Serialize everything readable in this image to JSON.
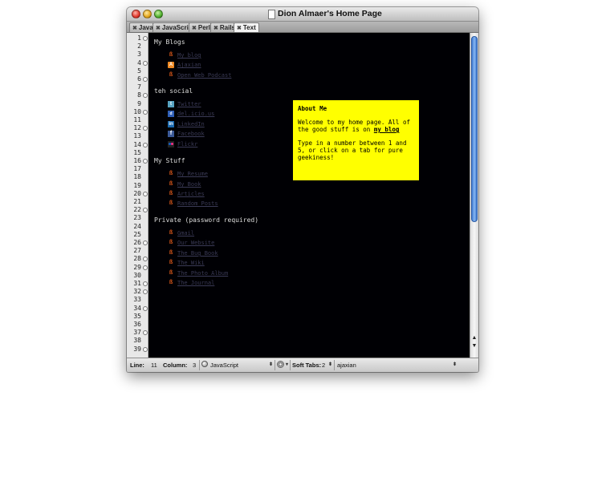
{
  "window": {
    "title": "Dion Almaer's Home Page",
    "tabs": [
      {
        "label": "Java",
        "active": false
      },
      {
        "label": "JavaScript",
        "active": false
      },
      {
        "label": "Perl",
        "active": false
      },
      {
        "label": "Rails",
        "active": false
      },
      {
        "label": "Text",
        "active": true
      }
    ]
  },
  "gutter": {
    "line_numbers": [
      "1",
      "2",
      "3",
      "4",
      "5",
      "6",
      "7",
      "8",
      "9",
      "10",
      "11",
      "12",
      "13",
      "14",
      "15",
      "16",
      "17",
      "18",
      "19",
      "20",
      "21",
      "22",
      "23",
      "24",
      "25",
      "26",
      "27",
      "28",
      "29",
      "30",
      "31",
      "32",
      "33",
      "34",
      "35",
      "36",
      "37",
      "38",
      "39"
    ]
  },
  "content": {
    "blogs": {
      "heading": "My Blogs",
      "items": [
        {
          "icon": "blog-icon",
          "label": "My blog"
        },
        {
          "icon": "rss-icon",
          "label": "Ajaxian"
        },
        {
          "icon": "blog-icon",
          "label": "Open Web Podcast"
        }
      ]
    },
    "social": {
      "heading": "teh social",
      "items": [
        {
          "icon": "twitter-icon",
          "label": "Twitter"
        },
        {
          "icon": "delicious-icon",
          "label": "del.icio.us"
        },
        {
          "icon": "linkedin-icon",
          "label": "LinkedIn"
        },
        {
          "icon": "facebook-icon",
          "label": "Facebook"
        },
        {
          "icon": "flickr-icon",
          "label": "Flickr"
        }
      ]
    },
    "stuff": {
      "heading": "My Stuff",
      "items": [
        {
          "icon": "blog-icon",
          "label": "My Resume"
        },
        {
          "icon": "blog-icon",
          "label": "My Book"
        },
        {
          "icon": "blog-icon",
          "label": "Articles"
        },
        {
          "icon": "blog-icon",
          "label": "Random Posts"
        }
      ]
    },
    "private": {
      "heading": "Private (password required)",
      "items": [
        {
          "icon": "blog-icon",
          "label": "Gmail"
        },
        {
          "icon": "blog-icon",
          "label": "Our Website"
        },
        {
          "icon": "blog-icon",
          "label": "The Bug Book"
        },
        {
          "icon": "blog-icon",
          "label": "The Wiki"
        },
        {
          "icon": "blog-icon",
          "label": "The Photo Album"
        },
        {
          "icon": "blog-icon",
          "label": "The Journal"
        }
      ]
    }
  },
  "about": {
    "heading": "About Me",
    "text_before_link": "Welcome to my home page. All of the good stuff is on",
    "link": "my blog",
    "instructions": "Type in a number between 1 and 5, or click on a tab for pure geekiness!"
  },
  "statusbar": {
    "line_label": "Line:",
    "line_value": "11",
    "column_label": "Column:",
    "column_value": "3",
    "language": "JavaScript",
    "soft_tabs_label": "Soft Tabs:",
    "soft_tabs_value": "2",
    "symbol": "ajaxian"
  },
  "colors": {
    "editor_bg": "#000004",
    "about_bg": "#ffff00",
    "scroll_thumb": "#4a86d8"
  }
}
